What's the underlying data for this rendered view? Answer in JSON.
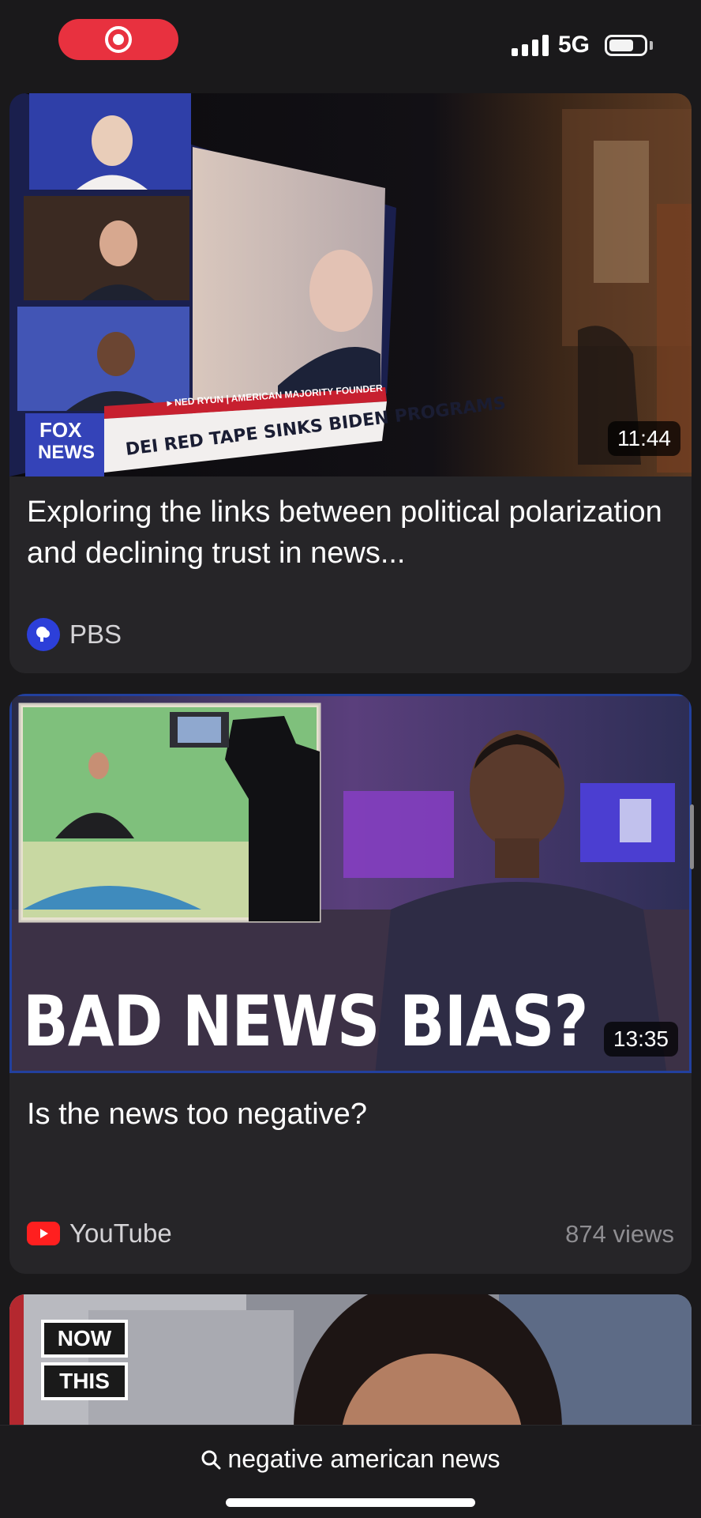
{
  "status_bar": {
    "network": "5G",
    "recording_color": "#e8313f",
    "icons": [
      "record-icon",
      "cellular-signal-icon",
      "battery-icon"
    ]
  },
  "results": [
    {
      "thumbnail": {
        "duration": "11:44",
        "chyron_text": "DEI RED TAPE SINKS BIDEN PROGRAMS",
        "ticker_text": "▸ NED RYUN | AMERICAN MAJORITY FOUNDER",
        "network_logo": [
          "FOX",
          "NEWS"
        ]
      },
      "title": "Exploring the links between political polarization and declining trust in news...",
      "source": {
        "name": "PBS",
        "icon": "pbs-logo-icon"
      }
    },
    {
      "thumbnail": {
        "duration": "13:35",
        "overlay_text": "BAD NEWS BIAS?"
      },
      "title": "Is the news too negative?",
      "source": {
        "name": "YouTube",
        "icon": "youtube-logo-icon"
      },
      "views": "874 views"
    },
    {
      "thumbnail": {
        "logo_lines": [
          "NOW",
          "THIS"
        ]
      }
    }
  ],
  "bottom_bar": {
    "search_query": "negative american news",
    "search_icon": "search-icon"
  },
  "colors": {
    "background": "#1a191b",
    "card": "#262528",
    "accent_red": "#e8313f",
    "pbs_blue": "#2c3fd9",
    "youtube_red": "#ff1f1f"
  }
}
